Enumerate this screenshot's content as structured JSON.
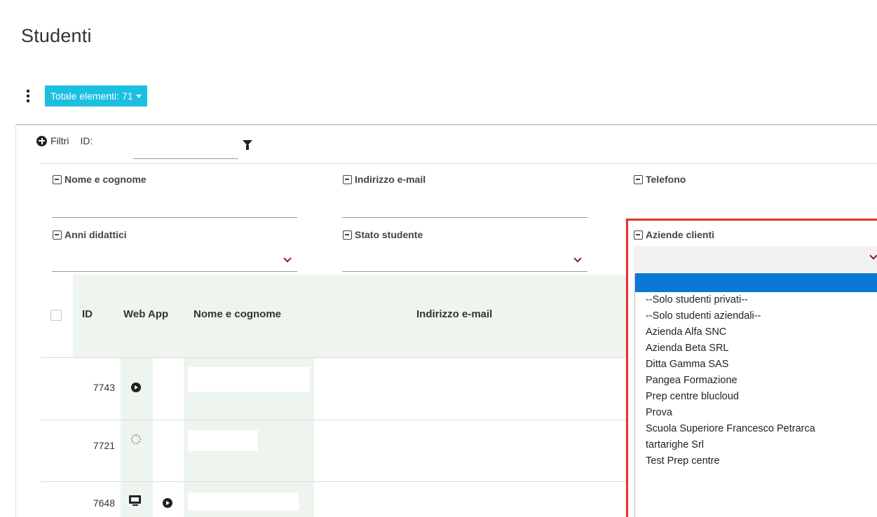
{
  "page": {
    "title": "Studenti"
  },
  "toolbar": {
    "total_label": "Totale elementi: 71"
  },
  "filters": {
    "filtri_label": "Filtri",
    "id_label": "ID:",
    "id_value": "",
    "nome_label": "Nome e cognome",
    "email_label": "Indirizzo e-mail",
    "telefono_label": "Telefono",
    "anni_label": "Anni didattici",
    "stato_label": "Stato studente",
    "aziende_label": "Aziende clienti"
  },
  "aziende_dropdown": {
    "options": [
      "",
      "--Solo studenti privati--",
      "--Solo studenti aziendali--",
      "Azienda Alfa SNC",
      "Azienda Beta SRL",
      "Ditta Gamma SAS",
      "Pangea Formazione",
      "Prep centre blucloud",
      "Prova",
      "Scuola Superiore Francesco Petrarca",
      "tartarighe Srl",
      "Test Prep centre"
    ],
    "selected_index": 0
  },
  "table": {
    "headers": {
      "id": "ID",
      "web_app": "Web App",
      "nome": "Nome e cognome",
      "email": "Indirizzo e-mail"
    },
    "rows": [
      {
        "id": "7743",
        "web_icon": "play-circle-icon",
        "app_icon": ""
      },
      {
        "id": "7721",
        "web_icon": "spinner-icon",
        "app_icon": ""
      },
      {
        "id": "7648",
        "web_icon": "monitor-icon",
        "app_icon": "play-circle-icon"
      }
    ]
  },
  "colors": {
    "accent": "#1bbfe0",
    "highlight": "#e8302e",
    "chevron": "#8b1a1a",
    "selected_option": "#0a78d7"
  }
}
